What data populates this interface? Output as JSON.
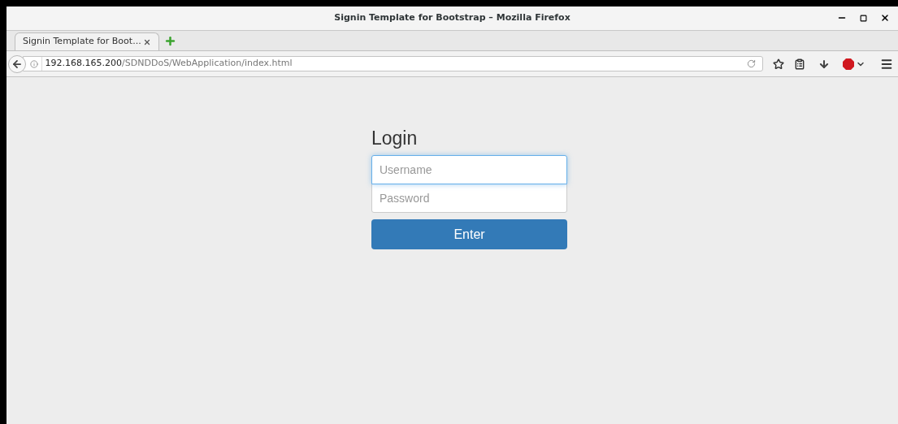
{
  "window": {
    "title": "Signin Template for Bootstrap – Mozilla Firefox"
  },
  "tabs": [
    {
      "label": "Signin Template for Boot...",
      "selected": true
    }
  ],
  "address_bar": {
    "host": "192.168.165.200",
    "path": "/SDNDDoS/WebApplication/index.html"
  },
  "form": {
    "heading": "Login",
    "fields": [
      {
        "placeholder": "Username",
        "focused": true
      },
      {
        "placeholder": "Password",
        "focused": false
      }
    ],
    "button": "Enter"
  }
}
